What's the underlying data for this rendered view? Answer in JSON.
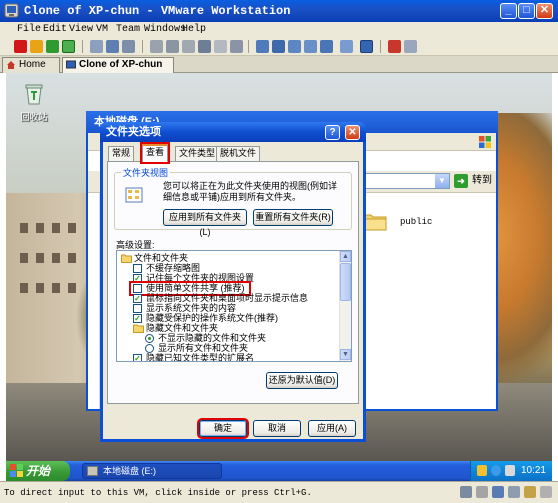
{
  "vmware": {
    "title": "Clone of XP-chun - VMware Workstation",
    "menu": [
      "File",
      "Edit",
      "View",
      "VM",
      "Team",
      "Windows",
      "Help"
    ],
    "tabs": [
      {
        "label": "Home"
      },
      {
        "label": "Clone of XP-chun"
      }
    ],
    "status_text": "To direct input to this VM, click inside or press Ctrl+G."
  },
  "desktop": {
    "recycle_bin_label": "回收站"
  },
  "explorer": {
    "title": "本地磁盘 (E:)",
    "go_label": "转到",
    "folder_name": "public"
  },
  "dialog": {
    "title": "文件夹选项",
    "help_glyph": "?",
    "close_glyph": "✕",
    "tabs": [
      "常规",
      "查看",
      "文件类型",
      "脱机文件"
    ],
    "active_tab": "查看",
    "folder_views": {
      "legend": "文件夹视图",
      "description": "您可以将正在为此文件夹使用的视图(例如详细信息或平铺)应用到所有文件夹。",
      "apply_all_button": "应用到所有文件夹(L)",
      "reset_all_button": "重置所有文件夹(R)"
    },
    "advanced_label": "高级设置:",
    "advanced_items": [
      {
        "type": "folder",
        "label": "文件和文件夹",
        "indent": 0
      },
      {
        "type": "checkbox",
        "label": "不缓存缩略图",
        "checked": false,
        "indent": 1
      },
      {
        "type": "checkbox",
        "label": "记住每个文件夹的视图设置",
        "checked": true,
        "indent": 1
      },
      {
        "type": "checkbox",
        "label": "使用简单文件共享 (推荐)",
        "checked": false,
        "indent": 1,
        "highlight": true
      },
      {
        "type": "checkbox",
        "label": "鼠标指向文件夹和桌面项时显示提示信息",
        "checked": true,
        "indent": 1
      },
      {
        "type": "checkbox",
        "label": "显示系统文件夹的内容",
        "checked": false,
        "indent": 1
      },
      {
        "type": "checkbox",
        "label": "隐藏受保护的操作系统文件(推荐)",
        "checked": true,
        "indent": 1
      },
      {
        "type": "folder",
        "label": "隐藏文件和文件夹",
        "indent": 1
      },
      {
        "type": "radio",
        "label": "不显示隐藏的文件和文件夹",
        "checked": true,
        "indent": 2
      },
      {
        "type": "radio",
        "label": "显示所有文件和文件夹",
        "checked": false,
        "indent": 2
      },
      {
        "type": "checkbox",
        "label": "隐藏已知文件类型的扩展名",
        "checked": true,
        "indent": 1
      }
    ],
    "restore_defaults_button": "还原为默认值(D)",
    "ok_button": "确定",
    "cancel_button": "取消",
    "apply_button": "应用(A)"
  },
  "taskbar": {
    "start_label": "开始",
    "task_item_label": "本地磁盘 (E:)",
    "clock": "10:21"
  },
  "colors": {
    "xp_blue": "#0a4fd6",
    "start_green": "#3a9d37",
    "highlight_red": "#e00000"
  }
}
